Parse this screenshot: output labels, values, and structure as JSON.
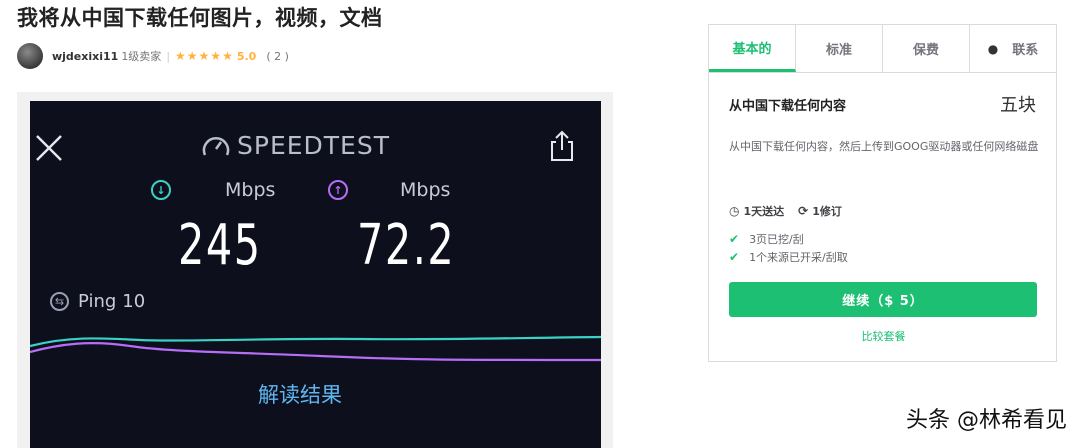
{
  "page": {
    "title": "我将从中国下载任何图片，视频，文档"
  },
  "seller": {
    "name": "wjdexixi11",
    "level": "1级卖家",
    "stars": "★★★★★",
    "rating": "5.0",
    "review_count": "( 2 )"
  },
  "gallery": {
    "brand": "SPEEDTEST",
    "download_unit": "Mbps",
    "upload_unit": "Mbps",
    "download_value": "245",
    "upload_value": "72.2",
    "ping_label": "Ping",
    "ping_value": "10",
    "result_link": "解读结果",
    "colors": {
      "download": "#3ad2c5",
      "upload": "#b56ef5",
      "link": "#5fb6ef"
    }
  },
  "package": {
    "tabs": [
      {
        "label": "基本的",
        "active": true
      },
      {
        "label": "标准",
        "active": false
      },
      {
        "label": "保费",
        "active": false
      },
      {
        "label": "联系",
        "active": false
      }
    ],
    "title": "从中国下载任何内容",
    "price": "五块",
    "description": "从中国下载任何内容，然后上传到GOOG驱动器或任何网络磁盘",
    "delivery": "1天送达",
    "revisions": "1修订",
    "features": [
      "3页已挖/刮",
      "1个来源已开采/刮取"
    ],
    "continue_label": "继续（$ 5）",
    "compare_label": "比较套餐",
    "accent_color": "#1dbf73"
  },
  "watermark": "头条 @林希看见"
}
